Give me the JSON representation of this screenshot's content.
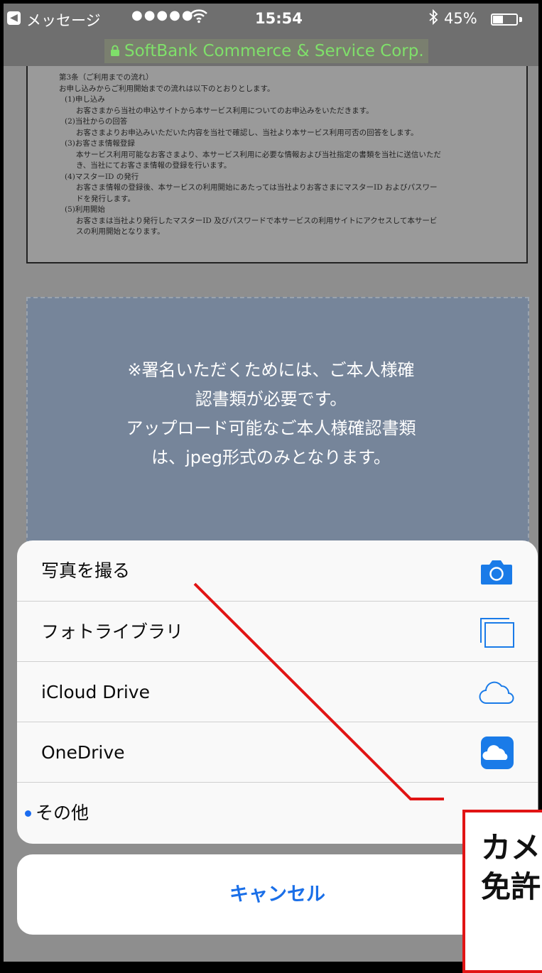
{
  "status_bar": {
    "back_app": "メッセージ",
    "signal": "●●●●●",
    "time": "15:54",
    "battery_percent": "45%",
    "battery_level": 0.45
  },
  "url_bar": {
    "domain": "SoftBank Commerce & Service Corp."
  },
  "document": {
    "lines": [
      "第3条（ご利用までの流れ）",
      "お申し込みからご利用開始までの流れは以下のとおりとします。",
      "(1)申し込み",
      "お客さまから当社の申込サイトから本サービス利用についてのお申込みをいただきます。",
      "(2)当社からの回答",
      "お客さまよりお申込みいただいた内容を当社で確認し、当社より本サービス利用可否の回答をします。",
      "(3)お客さま情報登録",
      "本サービス利用可能なお客さまより、本サービス利用に必要な情報および当社指定の書類を当社に送信いただ",
      "き、当社にてお客さま情報の登録を行います。",
      "(4)マスターID の発行",
      "お客さま情報の登録後、本サービスの利用開始にあたっては当社よりお客さまにマスターID およびパスワー",
      "ドを発行します。",
      "(5)利用開始",
      "お客さまは当社より発行したマスターID 及びパスワードで本サービスの利用サイトにアクセスして本サービ",
      "スの利用開始となります。"
    ]
  },
  "upload_area": {
    "line1": "※署名いただくためには、ご本人様確",
    "line2": "認書類が必要です。",
    "line3": "アップロード可能なご本人様確認書類",
    "line4": "は、jpeg形式のみとなります。"
  },
  "action_sheet": {
    "items": [
      {
        "label": "写真を撮る",
        "icon": "camera-icon"
      },
      {
        "label": "フォトライブラリ",
        "icon": "photo-library-icon"
      },
      {
        "label": "iCloud Drive",
        "icon": "icloud-icon"
      },
      {
        "label": "OneDrive",
        "icon": "onedrive-icon"
      },
      {
        "label": "その他",
        "icon": ""
      }
    ],
    "cancel_label": "キャンセル"
  },
  "annotation": {
    "line1": "カメ",
    "line2": "免許"
  },
  "colors": {
    "accent": "#1a6fe8",
    "annotation_red": "#e11414",
    "url_green": "#7fe06a"
  }
}
